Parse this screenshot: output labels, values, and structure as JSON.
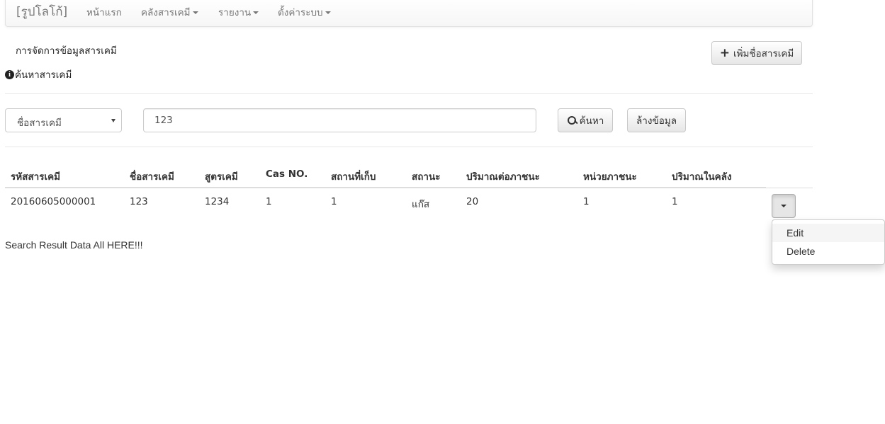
{
  "navbar": {
    "brand": "[รูปโลโก้]",
    "items": [
      {
        "label": "หน้าแรก",
        "dropdown": false
      },
      {
        "label": "คลังสารเคมี",
        "dropdown": true
      },
      {
        "label": "รายงาน",
        "dropdown": true
      },
      {
        "label": "ตั้งค่าระบบ",
        "dropdown": true
      }
    ]
  },
  "page": {
    "heading": "การจัดการข้อมูลสารเคมี",
    "add_button_label": "เพิ่มชื่อสารเคมี",
    "search_title": "ค้นหาสารเคมี"
  },
  "search": {
    "field_selected": "ชื่อสารเคมี",
    "query_value": "123",
    "search_button": "ค้นหา",
    "clear_button": "ล้างข้อมูล"
  },
  "table": {
    "headers": [
      "รหัสสารเคมี",
      "ชื่อสารเคมี",
      "สูตรเคมี",
      "Cas NO.",
      "สถานที่เก็บ",
      "สถานะ",
      "ปริมาณต่อภาชนะ",
      "หน่วยภาชนะ",
      "ปริมาณในคลัง"
    ],
    "rows": [
      [
        "20160605000001",
        "123",
        "1234",
        "1",
        "1",
        "แก๊ส",
        "20",
        "1",
        "1"
      ]
    ]
  },
  "row_menu": {
    "items": [
      "Edit",
      "Delete"
    ]
  },
  "result_note": "Search Result Data All HERE!!!"
}
